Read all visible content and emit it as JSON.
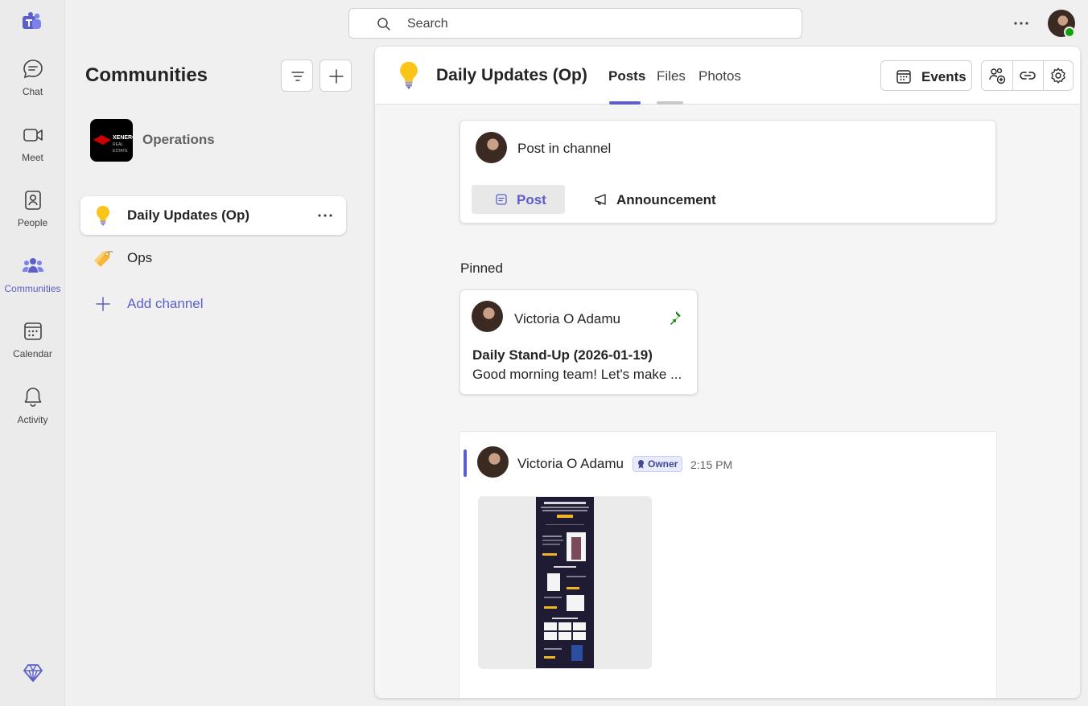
{
  "rail": {
    "items": [
      {
        "label": "Chat",
        "icon": "chat-icon"
      },
      {
        "label": "Meet",
        "icon": "video-icon"
      },
      {
        "label": "People",
        "icon": "people-icon"
      },
      {
        "label": "Communities",
        "icon": "communities-icon",
        "active": true
      },
      {
        "label": "Calendar",
        "icon": "calendar-icon"
      },
      {
        "label": "Activity",
        "icon": "bell-icon"
      }
    ]
  },
  "search": {
    "placeholder": "Search"
  },
  "sidebar": {
    "title": "Communities",
    "community_name": "Operations",
    "community_logo_text": "XENERO\nREAL ESTATE",
    "channels": [
      {
        "name": "Daily Updates (Op)",
        "emoji": "lightbulb",
        "active": true
      },
      {
        "name": "Ops",
        "emoji": "label-tag"
      }
    ],
    "add_channel": "Add channel"
  },
  "channel": {
    "title": "Daily Updates (Op)",
    "tabs": [
      {
        "label": "Posts",
        "active": true
      },
      {
        "label": "Files"
      },
      {
        "label": "Photos"
      }
    ],
    "events_label": "Events"
  },
  "compose": {
    "prompt": "Post in channel",
    "post_label": "Post",
    "announcement_label": "Announcement"
  },
  "pinned": {
    "label": "Pinned",
    "author": "Victoria O Adamu",
    "title": "Daily Stand-Up (2026-01-19)",
    "preview": "Good morning team!   Let's make ..."
  },
  "message": {
    "author": "Victoria O Adamu",
    "badge": "Owner",
    "time": "2:15 PM"
  },
  "colors": {
    "accent": "#5b5fc7",
    "presence": "#13a10e",
    "pin": "#0e7a0d"
  }
}
